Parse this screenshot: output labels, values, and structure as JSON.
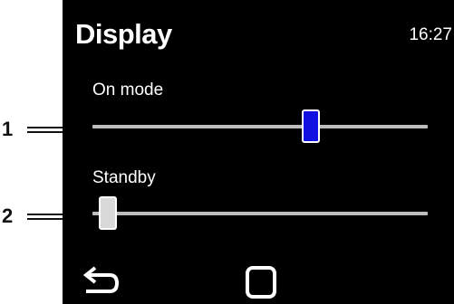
{
  "header": {
    "title": "Display",
    "clock": "16:27"
  },
  "sliders": [
    {
      "label": "On mode",
      "value": 0.66,
      "thumb_color": "#1010e0"
    },
    {
      "label": "Standby",
      "value": 0.02,
      "thumb_color": "#d9d9d9"
    }
  ],
  "callouts": [
    "1",
    "2"
  ],
  "nav": {
    "back_icon": "back-arrow-icon",
    "home_icon": "home-square-icon"
  },
  "colors": {
    "screen_bg": "#000000",
    "track": "#bdbdbd"
  }
}
